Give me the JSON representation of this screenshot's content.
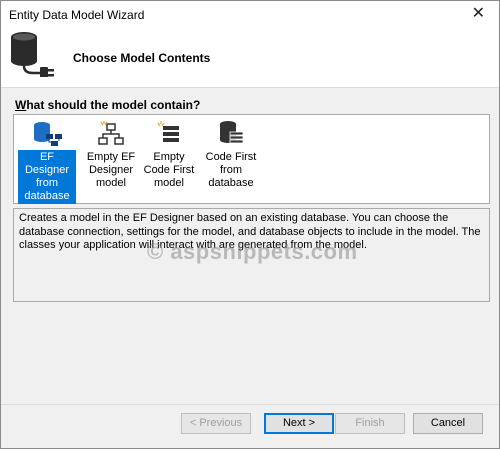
{
  "window": {
    "title": "Entity Data Model Wizard",
    "close_glyph": "✕"
  },
  "header": {
    "heading": "Choose Model Contents",
    "icon": "database-plug-icon"
  },
  "prompt": {
    "prefix": "W",
    "rest": "hat should the model contain?"
  },
  "options": [
    {
      "label": "EF Designer from database",
      "icon": "ef-designer-from-database-icon",
      "selected": true
    },
    {
      "label": "Empty EF Designer model",
      "icon": "empty-ef-designer-icon",
      "selected": false
    },
    {
      "label": "Empty Code First model",
      "icon": "empty-code-first-icon",
      "selected": false
    },
    {
      "label": "Code First from database",
      "icon": "code-first-from-database-icon",
      "selected": false
    }
  ],
  "description": "Creates a model in the EF Designer based on an existing database. You can choose the database connection, settings for the model, and database objects to include in the model. The classes your application will interact with are generated from the model.",
  "watermark": "© aspsnippets.com",
  "buttons": {
    "previous": "< Previous",
    "next": "Next >",
    "finish": "Finish",
    "cancel": "Cancel"
  },
  "colors": {
    "selection": "#0078d7",
    "icon_blue": "#1e6fc4",
    "icon_dark": "#333333",
    "icon_orange": "#e8a33d"
  }
}
